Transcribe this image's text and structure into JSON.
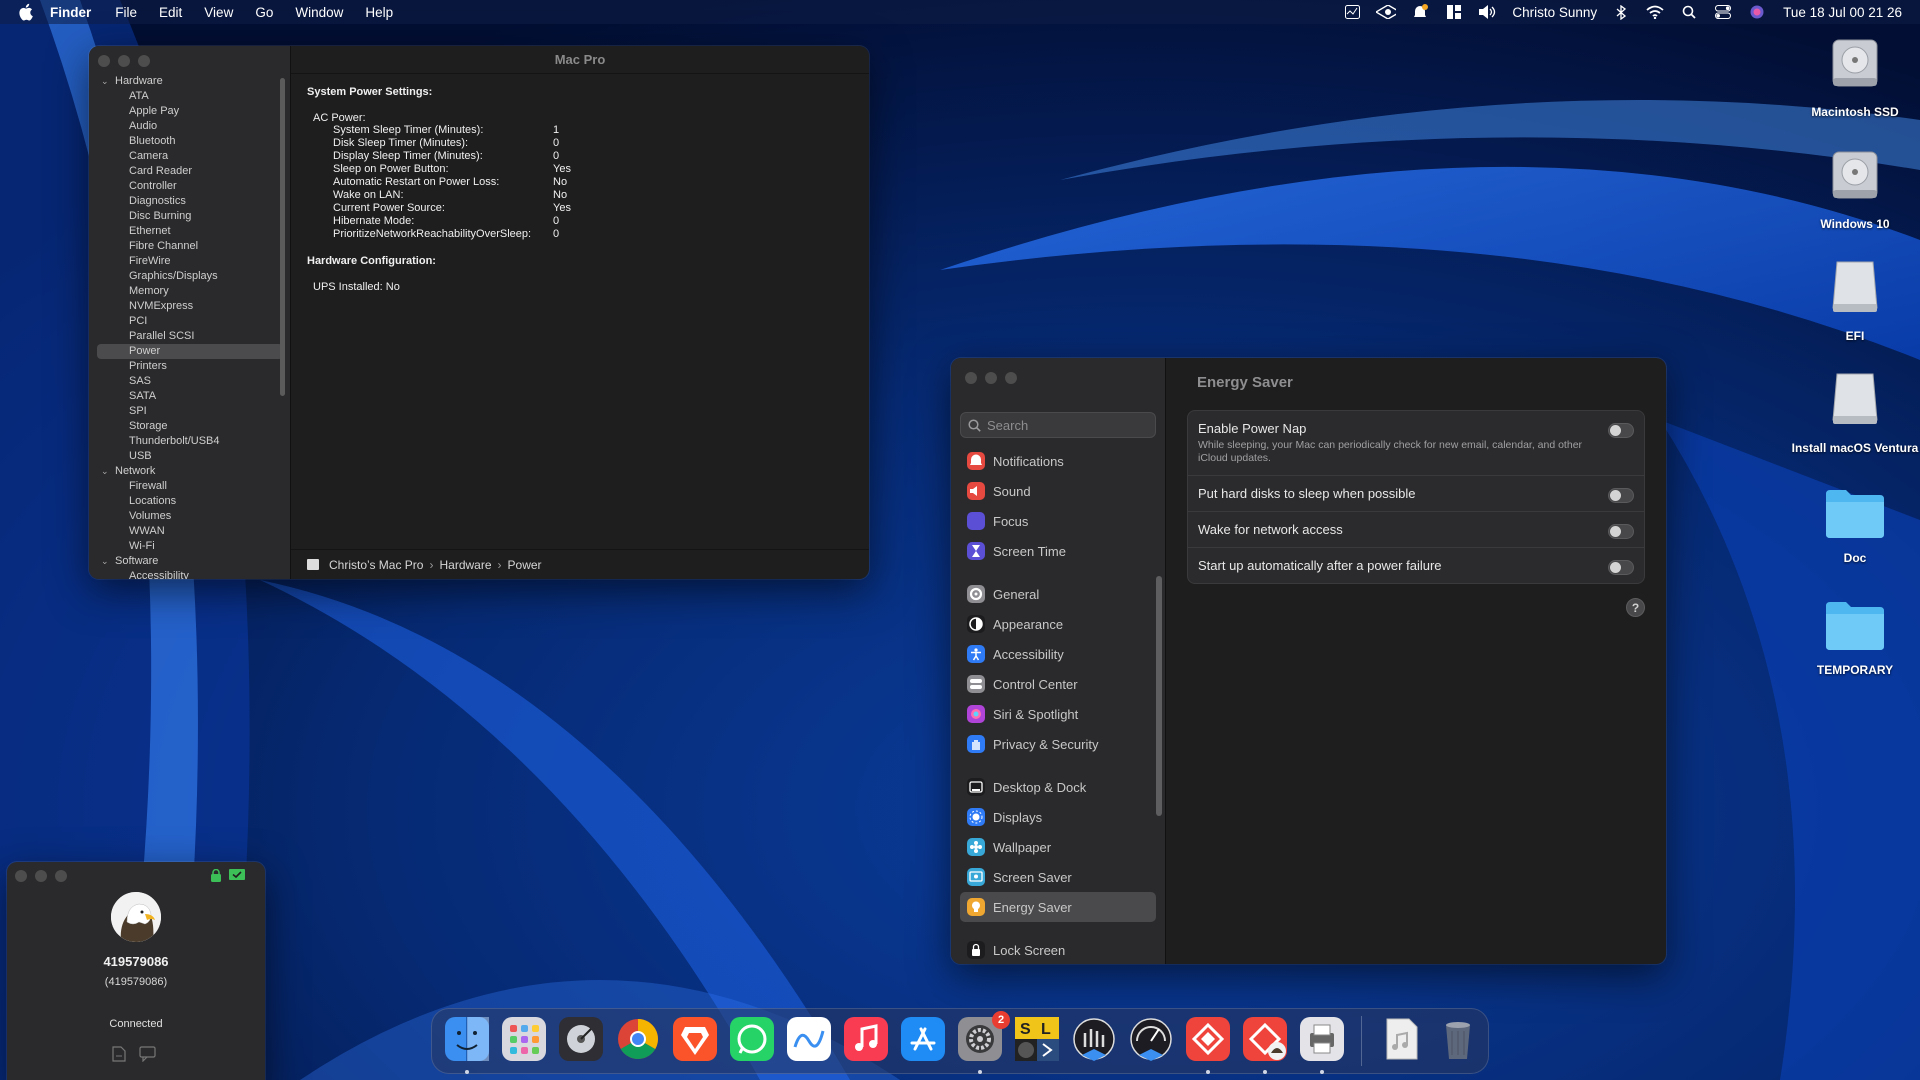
{
  "menubar": {
    "app_name": "Finder",
    "menus": [
      "File",
      "Edit",
      "View",
      "Go",
      "Window",
      "Help"
    ],
    "user": "Christo Sunny",
    "clock": "Tue 18 Jul  00 21 26"
  },
  "sysinfo": {
    "title": "Mac Pro",
    "tree": [
      {
        "type": "cat",
        "label": "Hardware"
      },
      {
        "type": "leaf",
        "label": "ATA"
      },
      {
        "type": "leaf",
        "label": "Apple Pay"
      },
      {
        "type": "leaf",
        "label": "Audio"
      },
      {
        "type": "leaf",
        "label": "Bluetooth"
      },
      {
        "type": "leaf",
        "label": "Camera"
      },
      {
        "type": "leaf",
        "label": "Card Reader"
      },
      {
        "type": "leaf",
        "label": "Controller"
      },
      {
        "type": "leaf",
        "label": "Diagnostics"
      },
      {
        "type": "leaf",
        "label": "Disc Burning"
      },
      {
        "type": "leaf",
        "label": "Ethernet"
      },
      {
        "type": "leaf",
        "label": "Fibre Channel"
      },
      {
        "type": "leaf",
        "label": "FireWire"
      },
      {
        "type": "leaf",
        "label": "Graphics/Displays"
      },
      {
        "type": "leaf",
        "label": "Memory"
      },
      {
        "type": "leaf",
        "label": "NVMExpress"
      },
      {
        "type": "leaf",
        "label": "PCI"
      },
      {
        "type": "leaf",
        "label": "Parallel SCSI"
      },
      {
        "type": "leaf",
        "label": "Power",
        "selected": true
      },
      {
        "type": "leaf",
        "label": "Printers"
      },
      {
        "type": "leaf",
        "label": "SAS"
      },
      {
        "type": "leaf",
        "label": "SATA"
      },
      {
        "type": "leaf",
        "label": "SPI"
      },
      {
        "type": "leaf",
        "label": "Storage"
      },
      {
        "type": "leaf",
        "label": "Thunderbolt/USB4"
      },
      {
        "type": "leaf",
        "label": "USB"
      },
      {
        "type": "cat",
        "label": "Network"
      },
      {
        "type": "leaf",
        "label": "Firewall"
      },
      {
        "type": "leaf",
        "label": "Locations"
      },
      {
        "type": "leaf",
        "label": "Volumes"
      },
      {
        "type": "leaf",
        "label": "WWAN"
      },
      {
        "type": "leaf",
        "label": "Wi-Fi"
      },
      {
        "type": "cat",
        "label": "Software"
      },
      {
        "type": "leaf",
        "label": "Accessibility"
      }
    ],
    "heading": "System Power Settings:",
    "ac_label": "AC Power:",
    "rows": [
      {
        "k": "System Sleep Timer (Minutes):",
        "v": "1"
      },
      {
        "k": "Disk Sleep Timer (Minutes):",
        "v": "0"
      },
      {
        "k": "Display Sleep Timer (Minutes):",
        "v": "0"
      },
      {
        "k": "Sleep on Power Button:",
        "v": "Yes"
      },
      {
        "k": "Automatic Restart on Power Loss:",
        "v": "No"
      },
      {
        "k": "Wake on LAN:",
        "v": "No"
      },
      {
        "k": "Current Power Source:",
        "v": "Yes"
      },
      {
        "k": "Hibernate Mode:",
        "v": "0"
      },
      {
        "k": "PrioritizeNetworkReachabilityOverSleep:",
        "v": "0"
      }
    ],
    "hw_heading": "Hardware Configuration:",
    "ups": "UPS Installed:  No",
    "path": [
      "Christo’s Mac Pro",
      "Hardware",
      "Power"
    ]
  },
  "settings": {
    "title": "Energy Saver",
    "search_placeholder": "Search",
    "nav": [
      {
        "label": "Notifications",
        "icon": "bell-icon",
        "color": "#e5493f"
      },
      {
        "label": "Sound",
        "icon": "speaker-icon",
        "color": "#e5493f"
      },
      {
        "label": "Focus",
        "icon": "moon-icon",
        "color": "#5b4fd6"
      },
      {
        "label": "Screen Time",
        "icon": "hourglass-icon",
        "color": "#5b4fd6"
      },
      {
        "gap": true
      },
      {
        "label": "General",
        "icon": "gear-icon",
        "color": "#8e8e93"
      },
      {
        "label": "Appearance",
        "icon": "appearance-icon",
        "color": "#1c1c1e"
      },
      {
        "label": "Accessibility",
        "icon": "accessibility-icon",
        "color": "#2f7bf6"
      },
      {
        "label": "Control Center",
        "icon": "control-center-icon",
        "color": "#8e8e93"
      },
      {
        "label": "Siri & Spotlight",
        "icon": "siri-icon",
        "color": "#b044d8"
      },
      {
        "label": "Privacy & Security",
        "icon": "hand-icon",
        "color": "#2f7bf6"
      },
      {
        "gap": true
      },
      {
        "label": "Desktop & Dock",
        "icon": "dock-icon",
        "color": "#1c1c1e"
      },
      {
        "label": "Displays",
        "icon": "sun-icon",
        "color": "#2f7bf6"
      },
      {
        "label": "Wallpaper",
        "icon": "flower-icon",
        "color": "#38a8d8"
      },
      {
        "label": "Screen Saver",
        "icon": "screensaver-icon",
        "color": "#38a8d8"
      },
      {
        "label": "Energy Saver",
        "icon": "bulb-icon",
        "color": "#f0a731",
        "selected": true
      },
      {
        "gap": true
      },
      {
        "label": "Lock Screen",
        "icon": "lock-icon",
        "color": "#1c1c1e"
      }
    ],
    "options": [
      {
        "label": "Enable Power Nap",
        "desc": "While sleeping, your Mac can periodically check for new email, calendar, and other iCloud updates.",
        "on": false
      },
      {
        "label": "Put hard disks to sleep when possible",
        "on": false
      },
      {
        "label": "Wake for network access",
        "on": false
      },
      {
        "label": "Start up automatically after a power failure",
        "on": false
      }
    ],
    "help": "?"
  },
  "remote": {
    "id": "419579086",
    "id_paren": "(419579086)",
    "status": "Connected"
  },
  "desktop": [
    {
      "name": "Macintosh SSD",
      "icon": "hard-drive-icon"
    },
    {
      "name": "Windows 10",
      "icon": "hard-drive-icon"
    },
    {
      "name": "EFI",
      "icon": "external-drive-icon"
    },
    {
      "name": "Install macOS Ventura",
      "icon": "external-drive-icon"
    },
    {
      "name": "Doc",
      "icon": "folder-icon"
    },
    {
      "name": "TEMPORARY",
      "icon": "folder-icon"
    }
  ],
  "dock": {
    "apps": [
      {
        "name": "finder",
        "color": "#3a8ff0",
        "running": true
      },
      {
        "name": "launchpad",
        "color": "#d8d8de"
      },
      {
        "name": "disk-utility",
        "color": "#3a3a40"
      },
      {
        "name": "chrome",
        "color": "#ffffff"
      },
      {
        "name": "brave",
        "color": "#fb542b"
      },
      {
        "name": "whatsapp",
        "color": "#25d366"
      },
      {
        "name": "freeform",
        "color": "#ffffff"
      },
      {
        "name": "music",
        "color": "#fa3c52"
      },
      {
        "name": "app-store",
        "color": "#1f8cf5"
      },
      {
        "name": "system-settings",
        "color": "#8e8e93",
        "running": true,
        "badge": "2"
      },
      {
        "name": "sl-utility",
        "color": "#f0c419"
      },
      {
        "name": "audio-mixer",
        "color": "#1c1c22"
      },
      {
        "name": "gauge",
        "color": "#1c1c22"
      },
      {
        "name": "anydesk",
        "color": "#ef443b",
        "running": true
      },
      {
        "name": "anydesk-admin",
        "color": "#ef443b",
        "running": true
      },
      {
        "name": "printer",
        "color": "#d8d8de",
        "running": true
      }
    ],
    "extra": [
      {
        "name": "music-document",
        "color": "#eeeeee"
      },
      {
        "name": "trash",
        "color": "#6b7280"
      }
    ]
  }
}
